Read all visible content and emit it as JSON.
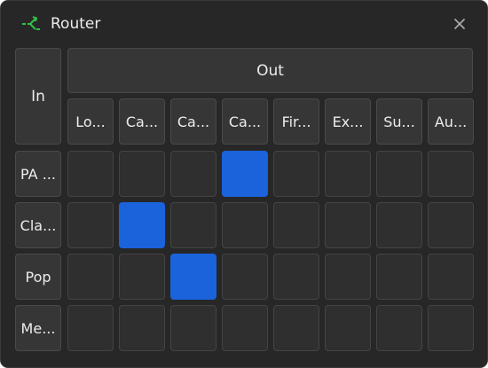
{
  "window": {
    "title": "Router",
    "icon": "router-icon",
    "close_icon": "close-icon"
  },
  "matrix": {
    "in_label": "In",
    "out_label": "Out",
    "columns": [
      "Lo...",
      "Ca...",
      "Ca...",
      "Ca...",
      "Fir...",
      "Ex...",
      "Su...",
      "Au..."
    ],
    "rows": [
      {
        "label": "PA ...",
        "active_column_index": 3
      },
      {
        "label": "Cla...",
        "active_column_index": 1
      },
      {
        "label": "Pop",
        "active_column_index": 2
      },
      {
        "label": "Me...",
        "active_column_index": null
      }
    ]
  },
  "colors": {
    "window_bg": "#272727",
    "cell_bg": "#2f2f2f",
    "active": "#1a63db",
    "icon_green": "#2fc24a"
  }
}
